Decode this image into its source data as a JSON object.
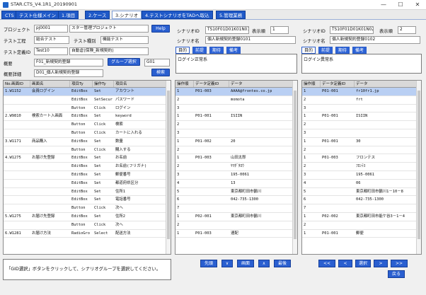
{
  "window": {
    "title": "STAR.CTS_V4.1R1_20190901",
    "min": "—",
    "max": "☐",
    "close": "✕"
  },
  "menu": [
    "CTS",
    "テスト仕様メイン",
    "1.項目",
    "2.ケース",
    "3.シナリオ",
    "4.テストシナリオをTADへ取込",
    "5.管理業務"
  ],
  "menu_active": 4,
  "form": {
    "project_label": "プロジェクト",
    "project_id": "pj0001",
    "project_name": "スター管理プロジェクト",
    "help": "Help",
    "process_label": "テスト工程",
    "process_value": "結合テスト",
    "kind_label": "テスト種別",
    "kind_value": "機能テスト",
    "testcase_label": "テスト定義ID",
    "testcase_id": "Test10",
    "testcase_name": "自動倉(保険_新規契約)",
    "summary_label": "概要",
    "summary_value": "F01_新規契約登録",
    "group_button": "グループ選択",
    "group_value": "G01",
    "detail_label": "概要詳細",
    "detail_value": "D01_個人新規契約登録",
    "search": "検索"
  },
  "scenario_left": {
    "id_label": "シナリオID",
    "id_value": "TS10F01D01K01N01",
    "order_label": "表示順",
    "order_value": "1",
    "name_label": "シナリオ名",
    "name_value": "個人新規契約登録0101",
    "tabs": [
      "目的",
      "前提",
      "期待",
      "備考"
    ],
    "content": "ログイン正常系"
  },
  "scenario_right": {
    "id_label": "シナリオID",
    "id_value": "TS10F01D01K01N02",
    "order_label": "表示順",
    "order_value": "2",
    "name_label": "シナリオ名",
    "name_value": "個人新規契約登録0102",
    "tabs": [
      "目的",
      "前提",
      "期待",
      "備考"
    ],
    "content": "ログイン異常系"
  },
  "left_grid": {
    "headers": [
      "No.画面ID",
      "画面名",
      "項目Ty",
      "操作Ty",
      "項目名"
    ],
    "rows": [
      [
        "1.W1152",
        "会員ログイン",
        "EditBox",
        "Set",
        "アカウント"
      ],
      [
        "",
        "",
        "EditBox",
        "SetSecur",
        "パスワード"
      ],
      [
        "",
        "",
        "Button",
        "Click",
        "ログイン"
      ],
      [
        "2.W9810",
        "検索カート入画面",
        "EditBox",
        "Set",
        "keyword"
      ],
      [
        "",
        "",
        "Button",
        "Click",
        "検索"
      ],
      [
        "",
        "",
        "Button",
        "Click",
        "カートに入れる"
      ],
      [
        "3.W1171",
        "商品購入",
        "EditBox",
        "Set",
        "数量"
      ],
      [
        "",
        "",
        "Button",
        "Click",
        "購入する"
      ],
      [
        "4.W1275",
        "お届け先登録",
        "EditBox",
        "Set",
        "お名前"
      ],
      [
        "",
        "",
        "EditBox",
        "Set",
        "お名前(フリガナ)"
      ],
      [
        "",
        "",
        "EditBox",
        "Set",
        "郵便番号"
      ],
      [
        "",
        "",
        "EditBox",
        "Set",
        "都道府県区分"
      ],
      [
        "",
        "",
        "EditBox",
        "Set",
        "住所1"
      ],
      [
        "",
        "",
        "EditBox",
        "Set",
        "電話番号"
      ],
      [
        "",
        "",
        "Button",
        "Click",
        "次へ"
      ],
      [
        "5.W1275",
        "お届け先登録",
        "EditBox",
        "Set",
        "住所2"
      ],
      [
        "",
        "",
        "Button",
        "Click",
        "次へ"
      ],
      [
        "6.W1281",
        "お届け方法",
        "RadioGro",
        "Select",
        "配送方法"
      ]
    ]
  },
  "mid_grid": {
    "headers": [
      "操作順",
      "データ定義ID",
      "データ"
    ],
    "rows": [
      [
        "1",
        "P01-003",
        "AAAA@frontes.co.jp"
      ],
      [
        "2",
        "",
        "momota"
      ],
      [
        "3",
        "",
        ""
      ],
      [
        "1",
        "P01-001",
        "ISIIN"
      ],
      [
        "2",
        "",
        ""
      ],
      [
        "3",
        "",
        ""
      ],
      [
        "1",
        "P01-002",
        "20"
      ],
      [
        "2",
        "",
        ""
      ],
      [
        "1",
        "P01-003",
        "山田太郎"
      ],
      [
        "2",
        "",
        "ﾔﾏﾀﾞﾀﾛｳ"
      ],
      [
        "3",
        "",
        "195-0061"
      ],
      [
        "4",
        "",
        "13"
      ],
      [
        "5",
        "",
        "東京都町田市鶴川"
      ],
      [
        "6",
        "",
        "042-735-1300"
      ],
      [
        "7",
        "",
        ""
      ],
      [
        "1",
        "P02-001",
        "東京都町田市鶴川"
      ],
      [
        "2",
        "",
        ""
      ],
      [
        "1",
        "P01-003",
        "速配"
      ]
    ]
  },
  "right_grid": {
    "headers": [
      "操作順",
      "データ定義ID",
      "データ"
    ],
    "rows": [
      [
        "1",
        "P01-001",
        "fr10fr1.jp"
      ],
      [
        "2",
        "",
        "frt"
      ],
      [
        "3",
        "",
        ""
      ],
      [
        "1",
        "P01-001",
        "ISIIN"
      ],
      [
        "2",
        "",
        ""
      ],
      [
        "3",
        "",
        ""
      ],
      [
        "1",
        "P01-001",
        "30"
      ],
      [
        "2",
        "",
        ""
      ],
      [
        "1",
        "P01-003",
        "フロンテス"
      ],
      [
        "2",
        "",
        "ﾌﾛﾝﾃｽ"
      ],
      [
        "3",
        "",
        "195-0061"
      ],
      [
        "4",
        "",
        "06"
      ],
      [
        "5",
        "",
        "東京都町田市鶴川1－10－8"
      ],
      [
        "6",
        "",
        "042-735-1300"
      ],
      [
        "7",
        "",
        ""
      ],
      [
        "1",
        "P02-002",
        "東京都町田市能ケ谷3－1－4"
      ],
      [
        "2",
        "",
        ""
      ],
      [
        "1",
        "P01-001",
        "郵便"
      ]
    ]
  },
  "message": "「GID選択」ボタンをクリックして、シナリオグループを選択してください。",
  "nav_mid": [
    "先頭",
    "∨",
    "画面",
    "∧",
    "最後"
  ],
  "nav_right": [
    "<<",
    "<",
    "選択",
    ">",
    ">>"
  ],
  "back": "戻る"
}
